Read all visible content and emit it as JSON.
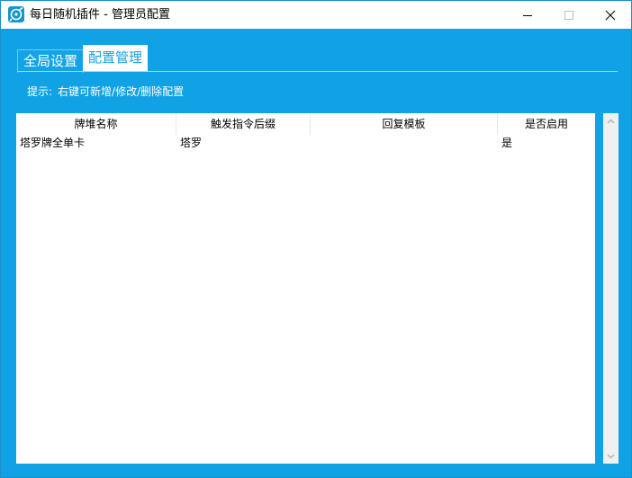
{
  "window": {
    "title": "每日随机插件 - 管理员配置"
  },
  "tabs": {
    "global_label": "全局设置",
    "manage_label": "配置管理",
    "active": "配置管理"
  },
  "hint": {
    "prefix": "提示:",
    "text": "右键可新增/修改/删除配置"
  },
  "table": {
    "columns": [
      "牌堆名称",
      "触发指令后缀",
      "回复模板",
      "是否启用"
    ],
    "rows": [
      {
        "name": "塔罗牌全单卡",
        "suffix": "塔罗",
        "template": "",
        "enabled": "是"
      }
    ]
  },
  "colors": {
    "accent": "#11a2e6",
    "tab_active_bg": "#ffffff",
    "scrollbar_bg": "#f0f0f0"
  },
  "icons": {
    "app": "app-icon",
    "minimize": "minimize-icon",
    "maximize": "maximize-icon",
    "close": "close-icon",
    "scroll_up": "chevron-up-icon",
    "scroll_down": "chevron-down-icon"
  }
}
